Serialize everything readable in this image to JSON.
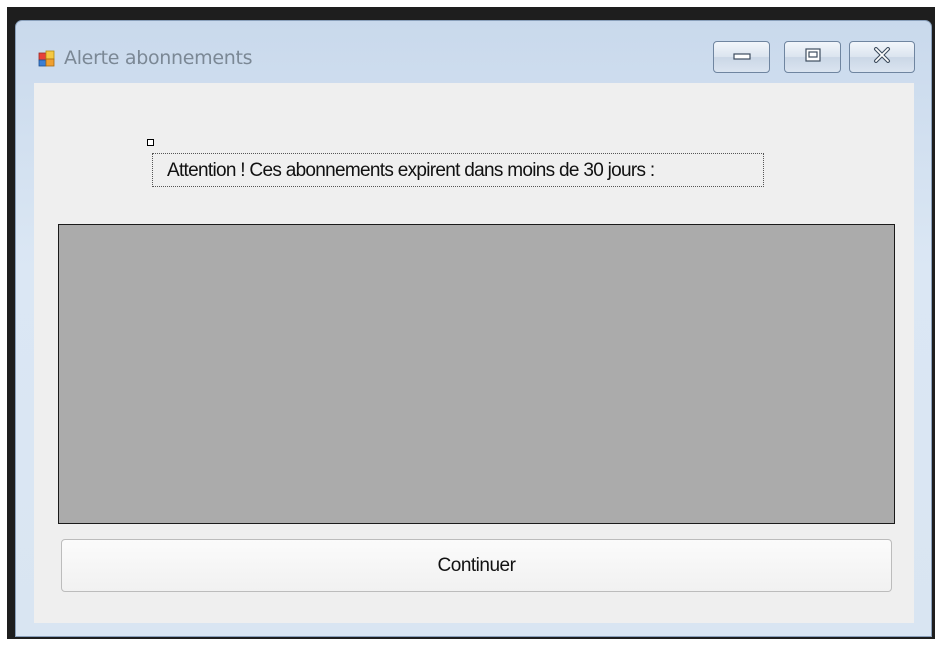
{
  "window": {
    "title": "Alerte abonnements",
    "icon": "windows-forms-app-icon",
    "controls": {
      "minimize_icon": "minimize-icon",
      "maximize_icon": "maximize-icon",
      "close_icon": "close-icon"
    }
  },
  "form": {
    "alert_label": "Attention ! Ces abonnements expirent dans moins de 30 jours :",
    "continue_button": "Continuer"
  },
  "colors": {
    "grid_background": "#ababab",
    "client_background": "#efefef",
    "title_text": "#7b8895"
  }
}
